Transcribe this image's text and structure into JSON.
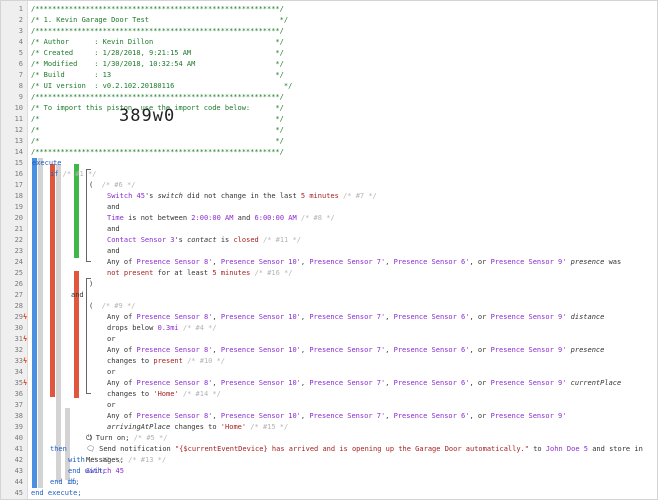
{
  "header": {
    "border": "/**********************************************************/",
    "title": "/* 1. Kevin Garage Door Test                               */",
    "author": "/* Author      : Kevin Dillon                             */",
    "created": "/* Created     : 1/28/2018, 9:21:15 AM                    */",
    "modified": "/* Modified    : 1/30/2018, 10:32:54 AM                   */",
    "build": "/* Build       : 13                                       */",
    "ui": "/* UI version  : v0.2.102.20180116                          */",
    "import1": "/* To import this piston, use the import code below:      */",
    "empty": "/*                                                        */",
    "import_code": "389w0"
  },
  "line_numbers": [
    "1",
    "2",
    "3",
    "4",
    "5",
    "6",
    "7",
    "8",
    "9",
    "10",
    "11",
    "12",
    "13",
    "14",
    "15",
    "16",
    "17",
    "18",
    "19",
    "20",
    "21",
    "22",
    "23",
    "24",
    "25",
    "26",
    "27",
    "28",
    "29",
    "30",
    "31",
    "32",
    "33",
    "34",
    "35",
    "36",
    "37",
    "38",
    "39",
    "40",
    "41",
    "42",
    "43",
    "44",
    "45"
  ],
  "code": {
    "execute": "execute",
    "if": "if",
    "if_c": "/* #1 */",
    "grp1_c": "/* #6 */",
    "l19_a": "Switch 45",
    "l19_b": "'s ",
    "l19_c": "switch",
    "l19_d": " did not change in the last ",
    "l19_e": "5 minutes",
    "l19_f": " /* #7 */",
    "and": "and",
    "l21_a": "Time",
    "l21_b": " is not between ",
    "l21_c": "2:00:00 AM",
    "l21_d": " and ",
    "l21_e": "6:00:00 AM",
    "l21_f": " /* #8 */",
    "l23_a": "Contact Sensor 3",
    "l23_b": "'s ",
    "l23_c": "contact",
    "l23_d": " is ",
    "l23_e": "closed",
    "l23_f": " /* #11 */",
    "any_of": "Any of ",
    "ps8": "Presence Sensor 8'",
    "ps10": "Presence Sensor 10'",
    "ps7": "Presence Sensor 7'",
    "ps6": "Presence Sensor 6'",
    "ps9": "Presence Sensor 9'",
    "comma": ", ",
    "or_sep": ", or ",
    "presence": "presence",
    "was": " was",
    "l25b_a": "not present",
    "l25b_b": " for at least ",
    "l25b_c": "5 minutes",
    "l25b_d": " /* #16 */",
    "grp2_c": "/* #9 */",
    "distance": "distance",
    "l30_a": "drops below ",
    "l30_b": "0.3mi",
    "l30_c": " /* #4 */",
    "or": "or",
    "l32_a": "changes to ",
    "l32_b": "present",
    "l32_c": " /* #10 */",
    "currentPlace": "currentPlace",
    "l34_b": "'Home'",
    "l34_c": " /* #14 */",
    "arrivingAtPlace": "arrivingAtPlace",
    "l36_a": " changes to ",
    "l36_b": "'Home'",
    "l36_c": " /* #15 */",
    "then": "then",
    "with": "with",
    "with_c": "/* #2 */",
    "switch45": "Switch 45",
    "do": "do",
    "turn_on": "Turn on;",
    "turn_on_c": " /* #5 */",
    "notif_a": "Send notification ",
    "notif_b": "\"{$currentEventDevice} has arrived and is opening up the Garage Door automatically.\"",
    "notif_c": " to ",
    "notif_d": "John Doe 5",
    "notif_e": " and store in",
    "notif_f": "Messages;",
    "notif_g": " /* #13 */",
    "end_with": "end with;",
    "end_if": "end if;",
    "end_execute": "end execute;"
  }
}
